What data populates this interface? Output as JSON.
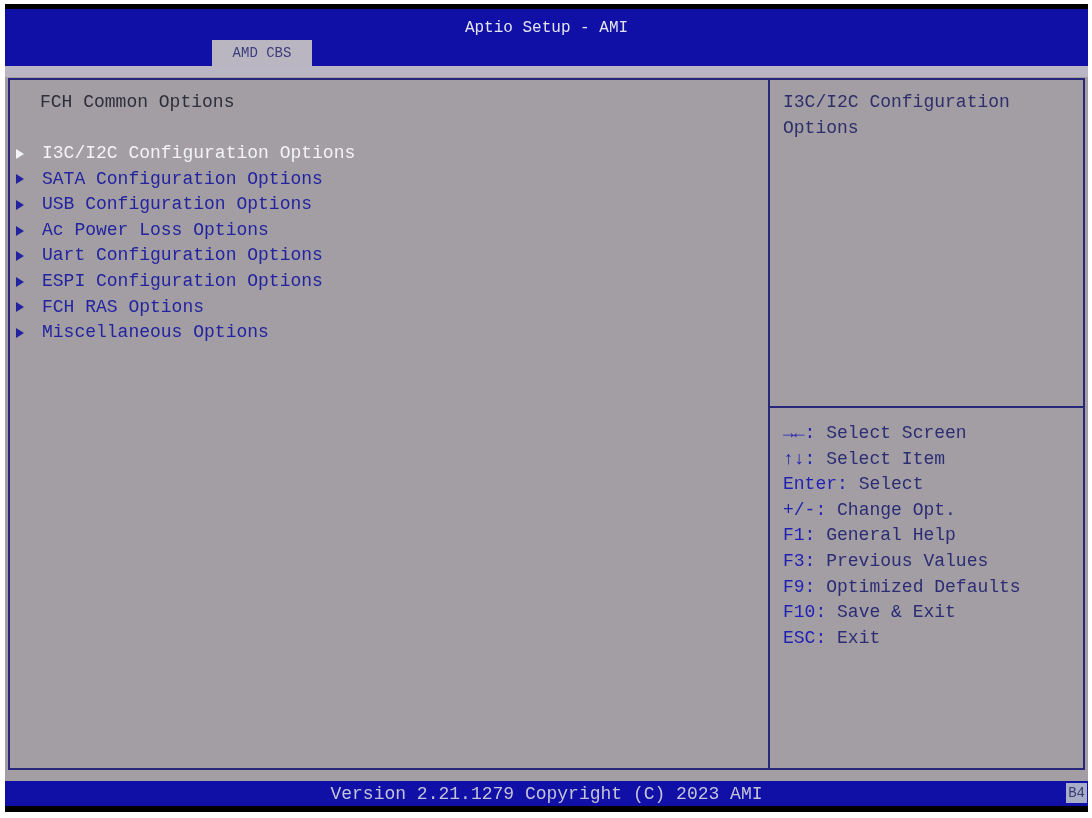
{
  "window": {
    "title": "Aptio Setup - AMI"
  },
  "tabs": [
    {
      "label": "AMD CBS",
      "selected": true
    }
  ],
  "page": {
    "title": "FCH Common Options",
    "items": [
      {
        "label": "I3C/I2C Configuration Options",
        "selected": true
      },
      {
        "label": "SATA Configuration Options",
        "selected": false
      },
      {
        "label": "USB Configuration Options",
        "selected": false
      },
      {
        "label": "Ac Power Loss Options",
        "selected": false
      },
      {
        "label": "Uart Configuration Options",
        "selected": false
      },
      {
        "label": "ESPI Configuration Options",
        "selected": false
      },
      {
        "label": "FCH RAS Options",
        "selected": false
      },
      {
        "label": "Miscellaneous Options",
        "selected": false
      }
    ]
  },
  "help": {
    "description": "I3C/I2C Configuration Options",
    "keys": [
      {
        "key": "→←:",
        "action": "Select Screen"
      },
      {
        "key": "↑↓:",
        "action": "Select Item"
      },
      {
        "key": "Enter:",
        "action": "Select"
      },
      {
        "key": "+/-:",
        "action": "Change Opt."
      },
      {
        "key": "F1:",
        "action": "General Help"
      },
      {
        "key": "F3:",
        "action": "Previous Values"
      },
      {
        "key": "F9:",
        "action": "Optimized Defaults"
      },
      {
        "key": "F10:",
        "action": "Save & Exit"
      },
      {
        "key": "ESC:",
        "action": "Exit"
      }
    ]
  },
  "status_bar": {
    "version": "Version 2.21.1279 Copyright (C) 2023 AMI",
    "code": "B4"
  }
}
